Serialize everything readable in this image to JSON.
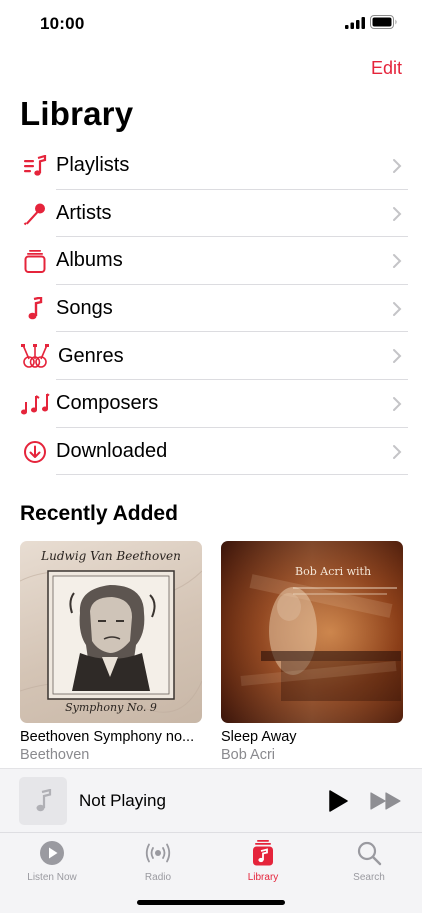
{
  "status": {
    "time": "10:00"
  },
  "header": {
    "edit_label": "Edit",
    "title": "Library"
  },
  "library_items": [
    {
      "label": "Playlists",
      "icon": "playlists-icon"
    },
    {
      "label": "Artists",
      "icon": "microphone-icon"
    },
    {
      "label": "Albums",
      "icon": "album-stack-icon"
    },
    {
      "label": "Songs",
      "icon": "music-note-icon"
    },
    {
      "label": "Genres",
      "icon": "guitars-icon"
    },
    {
      "label": "Composers",
      "icon": "composers-notes-icon"
    },
    {
      "label": "Downloaded",
      "icon": "download-circle-icon"
    }
  ],
  "recently_added": {
    "title": "Recently Added",
    "albums": [
      {
        "title": "Beethoven Symphony no...",
        "artist": "Beethoven",
        "art_text_top": "Ludwig Van Beethoven",
        "art_text_bottom": "Symphony No. 9"
      },
      {
        "title": "Sleep Away",
        "artist": "Bob Acri",
        "art_text_top": "Bob Acri with"
      }
    ]
  },
  "mini_player": {
    "title": "Not Playing"
  },
  "tabs": [
    {
      "label": "Listen Now",
      "icon": "play-circle-icon",
      "active": false
    },
    {
      "label": "Radio",
      "icon": "radio-waves-icon",
      "active": false
    },
    {
      "label": "Library",
      "icon": "library-icon",
      "active": true
    },
    {
      "label": "Search",
      "icon": "search-icon",
      "active": false
    }
  ],
  "colors": {
    "accent": "#e5243b",
    "chevron": "#c4c4c7",
    "secondary_text": "#8a8a8e"
  }
}
